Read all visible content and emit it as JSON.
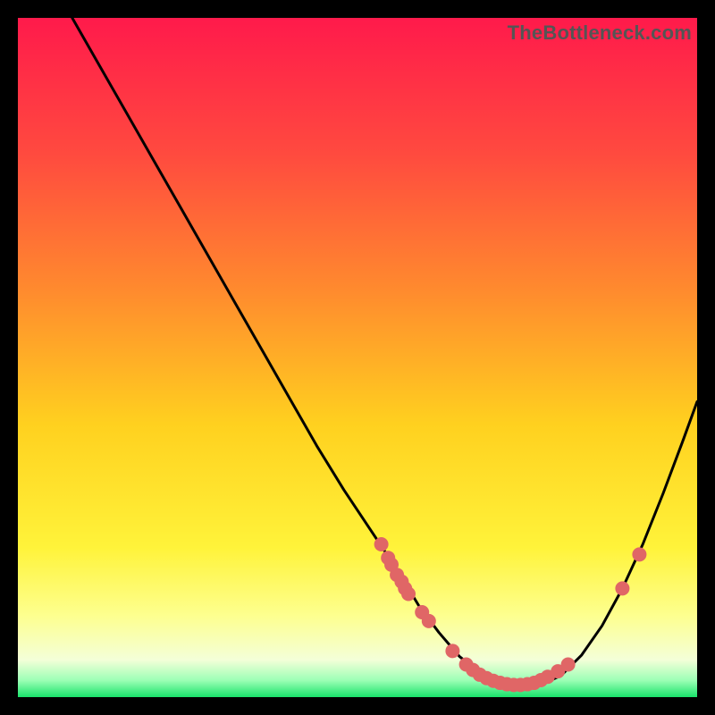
{
  "watermark": "TheBottleneck.com",
  "chart_data": {
    "type": "line",
    "title": "",
    "xlabel": "",
    "ylabel": "",
    "xlim": [
      0,
      100
    ],
    "ylim": [
      0,
      100
    ],
    "background_gradient": {
      "stops": [
        {
          "offset": 0.0,
          "color": "#ff1a4b"
        },
        {
          "offset": 0.2,
          "color": "#ff4a3f"
        },
        {
          "offset": 0.4,
          "color": "#ff8a2e"
        },
        {
          "offset": 0.6,
          "color": "#ffd11f"
        },
        {
          "offset": 0.78,
          "color": "#fff33a"
        },
        {
          "offset": 0.88,
          "color": "#fdff8f"
        },
        {
          "offset": 0.945,
          "color": "#f4ffd8"
        },
        {
          "offset": 0.975,
          "color": "#9dffb6"
        },
        {
          "offset": 1.0,
          "color": "#19e36b"
        }
      ]
    },
    "series": [
      {
        "name": "curve",
        "type": "line",
        "color": "#000000",
        "x": [
          8,
          12,
          16,
          20,
          24,
          28,
          32,
          36,
          40,
          44,
          48,
          52,
          56,
          59,
          62,
          65,
          68,
          71,
          74,
          77,
          80,
          83,
          86,
          89,
          92,
          95,
          98,
          100
        ],
        "y": [
          100,
          93,
          86,
          79,
          72,
          65,
          58,
          51,
          44,
          37,
          30.5,
          24.5,
          18.5,
          13.5,
          9.5,
          6.0,
          3.6,
          2.2,
          1.6,
          1.8,
          3.2,
          6.2,
          10.5,
          16.0,
          22.5,
          30.0,
          38.0,
          43.5
        ]
      },
      {
        "name": "left-cluster",
        "type": "scatter",
        "color": "#e06666",
        "x": [
          53.5,
          54.5,
          55.0,
          55.8,
          56.5,
          57.0,
          57.5
        ],
        "y": [
          22.5,
          20.5,
          19.5,
          18.0,
          17.0,
          16.0,
          15.2
        ]
      },
      {
        "name": "mid-pair",
        "type": "scatter",
        "color": "#e06666",
        "x": [
          59.5,
          60.5
        ],
        "y": [
          12.5,
          11.2
        ]
      },
      {
        "name": "valley-cluster",
        "type": "scatter",
        "color": "#e06666",
        "x": [
          64.0,
          66.0,
          67.0,
          68.0,
          69.0,
          70.0,
          71.0,
          72.0,
          73.0,
          74.0,
          75.0,
          76.0,
          77.0,
          78.0,
          79.5,
          81.0
        ],
        "y": [
          6.8,
          4.8,
          4.0,
          3.3,
          2.8,
          2.4,
          2.1,
          1.9,
          1.8,
          1.8,
          1.9,
          2.1,
          2.5,
          3.0,
          3.8,
          4.8
        ]
      },
      {
        "name": "right-pair",
        "type": "scatter",
        "color": "#e06666",
        "x": [
          89.0,
          91.5
        ],
        "y": [
          16.0,
          21.0
        ]
      }
    ]
  }
}
